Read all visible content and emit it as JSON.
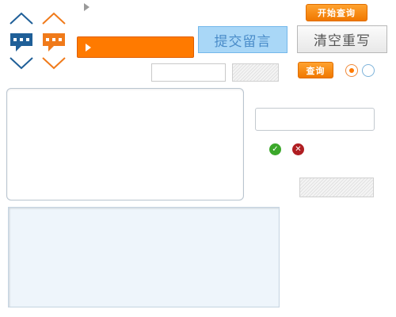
{
  "buttons": {
    "start_query": "开始查询",
    "submit_message": "提交留言",
    "clear_rewrite": "清空重写",
    "query": "查询"
  },
  "icons": {
    "blue_nav": "comment-up-down-icon",
    "orange_nav": "comment-up-down-icon",
    "play": "play-icon",
    "ok": "check-icon",
    "error": "close-icon"
  },
  "colors": {
    "accent_orange": "#ff7a00",
    "accent_blue": "#1f5f98",
    "submit_bg": "#a9d7f7",
    "ok_green": "#3ba82a",
    "error_red": "#b01e22"
  },
  "radios": {
    "selected_index": 0
  }
}
